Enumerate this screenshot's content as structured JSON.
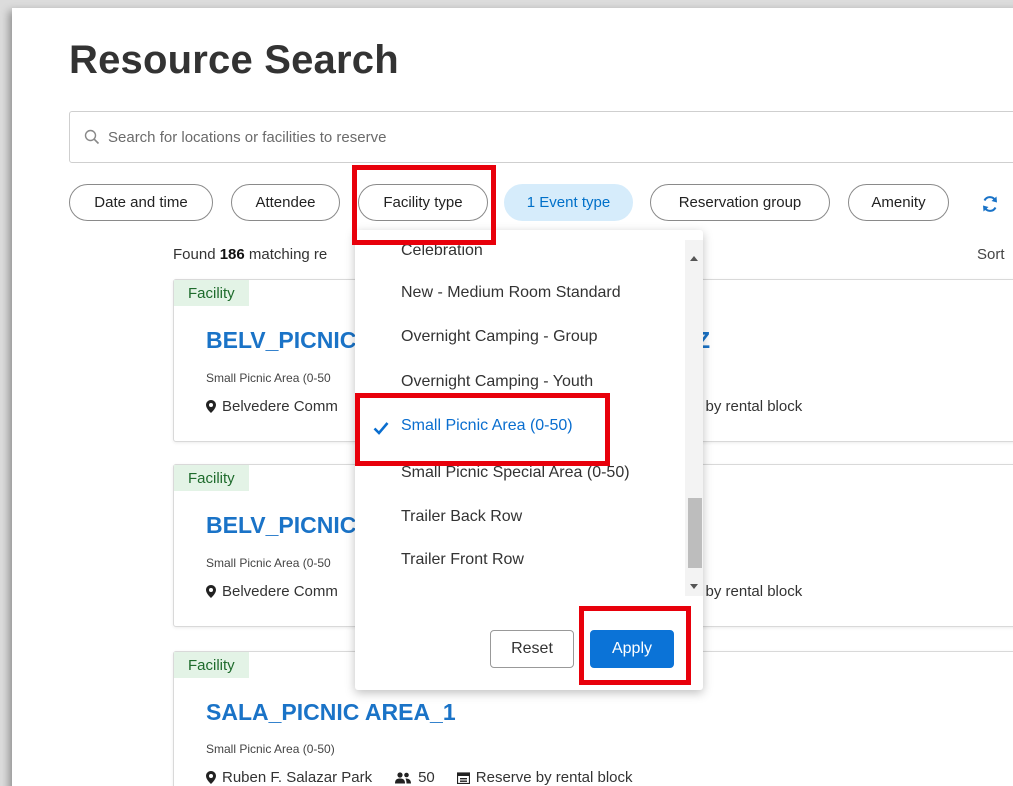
{
  "page": {
    "title": "Resource Search"
  },
  "search": {
    "placeholder": "Search for locations or facilities to reserve"
  },
  "filters": {
    "chips": [
      {
        "label": "Date and time"
      },
      {
        "label": "Attendee"
      },
      {
        "label": "Facility type"
      },
      {
        "label": "1 Event type"
      },
      {
        "label": "Reservation group"
      },
      {
        "label": "Amenity"
      }
    ]
  },
  "results": {
    "found_prefix": "Found ",
    "found_count": "186",
    "found_suffix": " matching re",
    "sort_label": "Sort"
  },
  "cards": [
    {
      "badge": "Facility",
      "name": "BELV_PICNIC",
      "name_tail": "Z",
      "sub": "Small Picnic Area (0-50",
      "location": "Belvedere Comm",
      "reserve": "e by rental block"
    },
    {
      "badge": "Facility",
      "name": "BELV_PICNIC",
      "sub": "Small Picnic Area (0-50",
      "location": "Belvedere Comm",
      "reserve": "e by rental block"
    },
    {
      "badge": "Facility",
      "name": "SALA_PICNIC AREA_1",
      "sub": "Small Picnic Area (0-50)",
      "location": "Ruben F. Salazar Park",
      "capacity": "50",
      "reserve": "Reserve by rental block"
    }
  ],
  "dropdown": {
    "items": [
      {
        "label": "Celebration",
        "selected": false
      },
      {
        "label": "New - Medium Room Standard",
        "selected": false
      },
      {
        "label": "Overnight Camping - Group",
        "selected": false
      },
      {
        "label": "Overnight Camping - Youth",
        "selected": false
      },
      {
        "label": "Small Picnic Area (0-50)",
        "selected": true
      },
      {
        "label": "Small Picnic Special Area (0-50)",
        "selected": false
      },
      {
        "label": "Trailer Back Row",
        "selected": false
      },
      {
        "label": "Trailer Front Row",
        "selected": false
      }
    ],
    "reset_label": "Reset",
    "apply_label": "Apply"
  },
  "colors": {
    "accent": "#0b73d7",
    "link": "#1a73c7",
    "highlight": "#e8000b",
    "badge_bg": "#e3f3e6",
    "active_chip_bg": "#d6ecfb"
  }
}
